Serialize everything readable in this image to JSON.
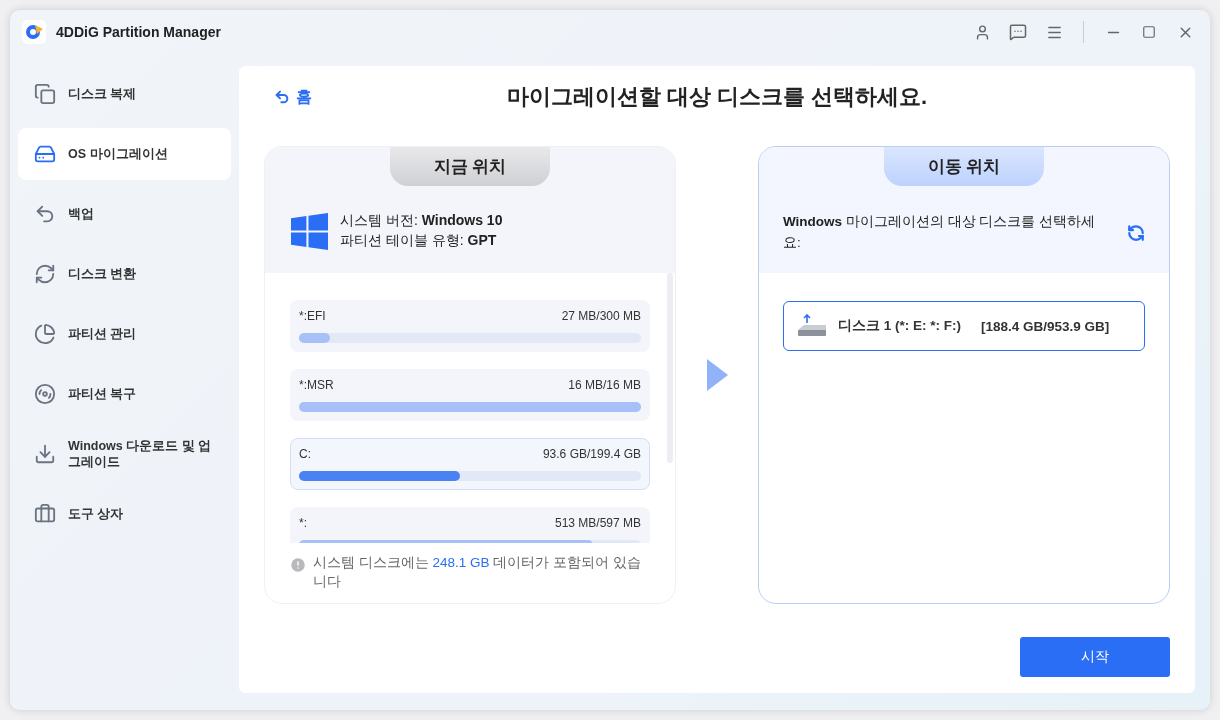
{
  "window": {
    "title": "4DDiG Partition Manager"
  },
  "sidebar": {
    "items": [
      {
        "label": "디스크 복제",
        "selected": false
      },
      {
        "label": "OS 마이그레이션",
        "selected": true
      },
      {
        "label": "백업",
        "selected": false
      },
      {
        "label": "디스크 변환",
        "selected": false
      },
      {
        "label": "파티션 관리",
        "selected": false
      },
      {
        "label": "파티션 복구",
        "selected": false
      },
      {
        "label": "Windows 다운로드 및 업그레이드",
        "selected": false
      },
      {
        "label": "도구 상자",
        "selected": false
      }
    ]
  },
  "back": {
    "label": "홈"
  },
  "heading": "마이그레이션할 대상 디스크를 선택하세요.",
  "source": {
    "tab": "지금 위치",
    "system_version": "시스템 버전: **Windows 10**",
    "partition_table": "파티션 테이블 유형: **GPT**",
    "partitions": [
      {
        "name": "*:EFI",
        "usage": "27 MB/300 MB",
        "level": 0.09,
        "selected": false
      },
      {
        "name": "*:MSR",
        "usage": "16 MB/16 MB",
        "level": 1,
        "selected": false
      },
      {
        "name": "C:",
        "usage": "93.6 GB/199.4 GB",
        "level": 0.47,
        "selected": true
      },
      {
        "name": "*:",
        "usage": "513 MB/597 MB",
        "level": 0.86,
        "selected": false
      }
    ],
    "note": {
      "before": "시스템 디스크에는 ",
      "highlight": "248.1 GB",
      "after": " 데이터가 포함되어 있습니다"
    }
  },
  "target": {
    "tab": "이동 위치",
    "prompt": "**Windows** 마이그레이션의 대상 디스크를 선택하세요:",
    "disks": [
      {
        "name": "디스크 1 (*: E: *: F:)",
        "size": "[188.4 GB/953.9 GB]",
        "selected": true
      }
    ]
  },
  "start_button": "시작"
}
